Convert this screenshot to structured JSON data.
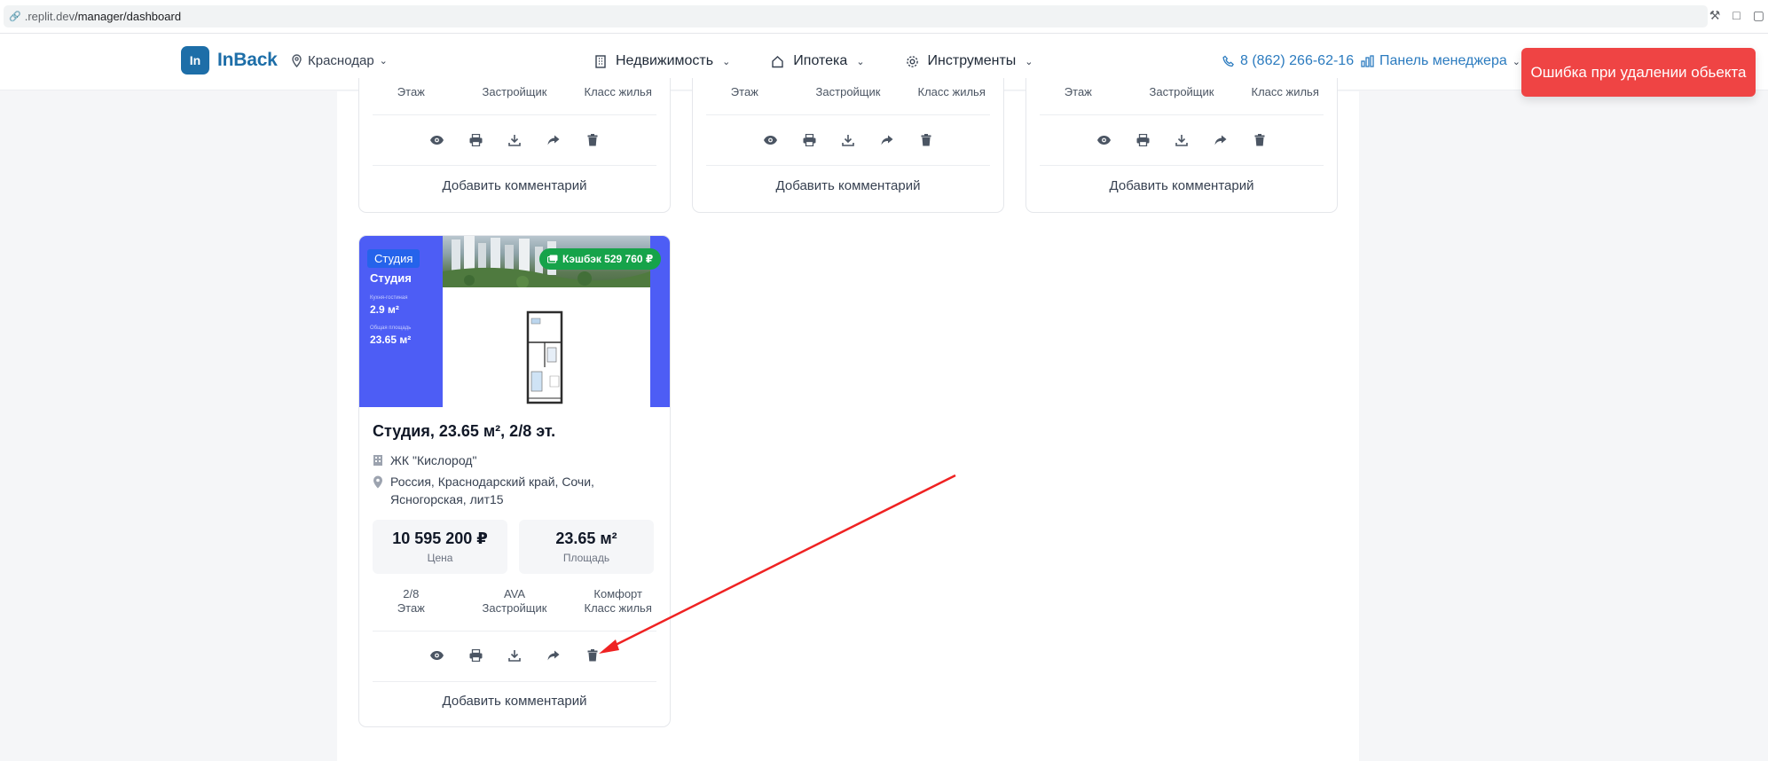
{
  "browser": {
    "url_host": ".replit.dev",
    "url_path": "/manager/dashboard"
  },
  "header": {
    "logo_mark": "In",
    "logo_text": "InBack",
    "city": "Краснодар",
    "nav": [
      {
        "label": "Недвижимость",
        "icon": "building-icon"
      },
      {
        "label": "Ипотека",
        "icon": "home-icon"
      },
      {
        "label": "Инструменты",
        "icon": "gear-icon"
      }
    ],
    "phone": "8 (862) 266-62-16",
    "manager_panel": "Панель менеджера"
  },
  "toast": {
    "message": "Ошибка при удалении обьекта",
    "color": "#ef4444"
  },
  "top_cards": [
    {
      "labels": [
        "Этаж",
        "Застройщик",
        "Класс жилья"
      ],
      "comment": "Добавить комментарий"
    },
    {
      "labels": [
        "Этаж",
        "Застройщик",
        "Класс жилья"
      ],
      "comment": "Добавить комментарий"
    },
    {
      "labels": [
        "Этаж",
        "Застройщик",
        "Класс жилья"
      ],
      "comment": "Добавить комментарий"
    }
  ],
  "listing": {
    "tag": "Студия",
    "banner_title": "Студия",
    "banner_label_1": "Кухня-гостиная",
    "banner_value_1": "2.9 м²",
    "banner_label_2": "Общая площадь",
    "banner_value_2": "23.65 м²",
    "cashback": "Кэшбэк 529 760 ₽",
    "title": "Студия, 23.65 м², 2/8 эт.",
    "complex": "ЖК \"Кислород\"",
    "address_line1": "Россия, Краснодарский край, Сочи,",
    "address_line2": "Ясногорская, лит15",
    "price": "10 595 200 ₽",
    "price_label": "Цена",
    "area": "23.65 м²",
    "area_label": "Площадь",
    "meta": [
      {
        "value": "2/8",
        "label": "Этаж"
      },
      {
        "value": "AVA",
        "label": "Застройщик"
      },
      {
        "value": "Комфорт",
        "label": "Класс жилья"
      }
    ],
    "comment": "Добавить комментарий"
  },
  "actions": [
    "eye-icon",
    "print-icon",
    "download-icon",
    "share-icon",
    "trash-icon"
  ],
  "colors": {
    "brand": "#1d6ea8",
    "banner": "#4d5df5",
    "cashback": "#16a34a",
    "annotation": "#ef2222"
  }
}
